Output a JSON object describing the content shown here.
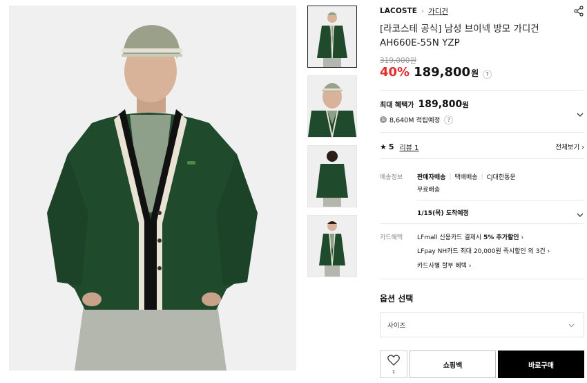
{
  "breadcrumb": {
    "brand": "LACOSTE",
    "separator": "›",
    "category": "가디건"
  },
  "product": {
    "title": "[라코스테 공식] 남성 브이넥 방모 가디건 AH660E-55N YZP",
    "original_price": "319,000원",
    "discount_rate": "40%",
    "sale_price": "189,800",
    "currency": "원",
    "help_mark": "?"
  },
  "benefit": {
    "label": "최대 혜택가",
    "price": "189,800",
    "currency": "원",
    "points_icon": "S",
    "points_text": "8,640M 적립예정"
  },
  "review": {
    "star": "★",
    "rating": "5",
    "review_label": "리뷰 1",
    "see_all": "전체보기 ›"
  },
  "shipping": {
    "label": "배송정보",
    "seller": "판매자배송",
    "type": "택배배송",
    "carrier": "CJ대한통운",
    "fee": "무료배송",
    "arrival": "1/15(목) 도착예정"
  },
  "card": {
    "label": "카드혜택",
    "line1_prefix": "LFmall 신용카드 결제시 ",
    "line1_bold": "5% 추가할인",
    "line1_arrow": "›",
    "line2": "LFpay NH카드 최대 20,000원 즉시할인 외 3건 ›",
    "line3": "카드사별 할부 혜택 ›"
  },
  "options": {
    "title": "옵션 선택",
    "size_placeholder": "사이즈"
  },
  "actions": {
    "wish_count": "1",
    "cart": "쇼핑백",
    "buy": "바로구매"
  },
  "colors": {
    "accent_discount": "#e52b2b",
    "sweater_green": "#1f4a2c",
    "buy_button": "#000000"
  },
  "icons": [
    "share-icon",
    "help-icon",
    "chevron-down-icon",
    "points-coin-icon",
    "star-icon",
    "heart-icon"
  ]
}
